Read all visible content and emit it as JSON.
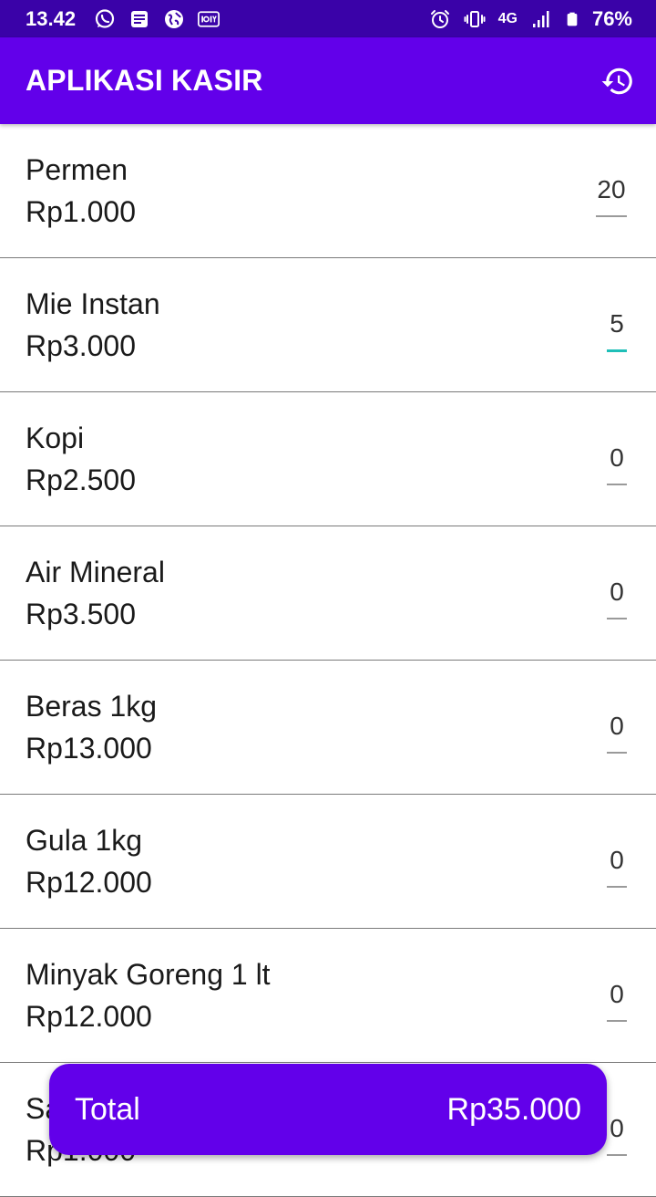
{
  "status_bar": {
    "time": "13.42",
    "network": "4G",
    "battery": "76%",
    "left_icons": [
      "whatsapp-icon",
      "news-icon",
      "globe-icon",
      "iqiyi-icon"
    ],
    "right_icons": [
      "alarm-icon",
      "vibrate-icon",
      "signal-icon",
      "battery-icon"
    ]
  },
  "app_bar": {
    "title": "APLIKASI KASIR",
    "action_icon": "history-icon",
    "color": "#6200ea"
  },
  "items": [
    {
      "name": "Permen",
      "price": "Rp1.000",
      "qty": "20"
    },
    {
      "name": "Mie Instan",
      "price": "Rp3.000",
      "qty": "5"
    },
    {
      "name": "Kopi",
      "price": "Rp2.500",
      "qty": "0"
    },
    {
      "name": "Air Mineral",
      "price": "Rp3.500",
      "qty": "0"
    },
    {
      "name": "Beras 1kg",
      "price": "Rp13.000",
      "qty": "0"
    },
    {
      "name": "Gula 1kg",
      "price": "Rp12.000",
      "qty": "0"
    },
    {
      "name": "Minyak Goreng 1 lt",
      "price": "Rp12.000",
      "qty": "0"
    },
    {
      "name": "Sabun",
      "price": "Rp1.000",
      "qty": "0"
    }
  ],
  "total": {
    "label": "Total",
    "value": "Rp35.000"
  },
  "colors": {
    "status_bar": "#3a02a8",
    "primary": "#6200ea",
    "focus_underline": "#1fbfb8"
  }
}
